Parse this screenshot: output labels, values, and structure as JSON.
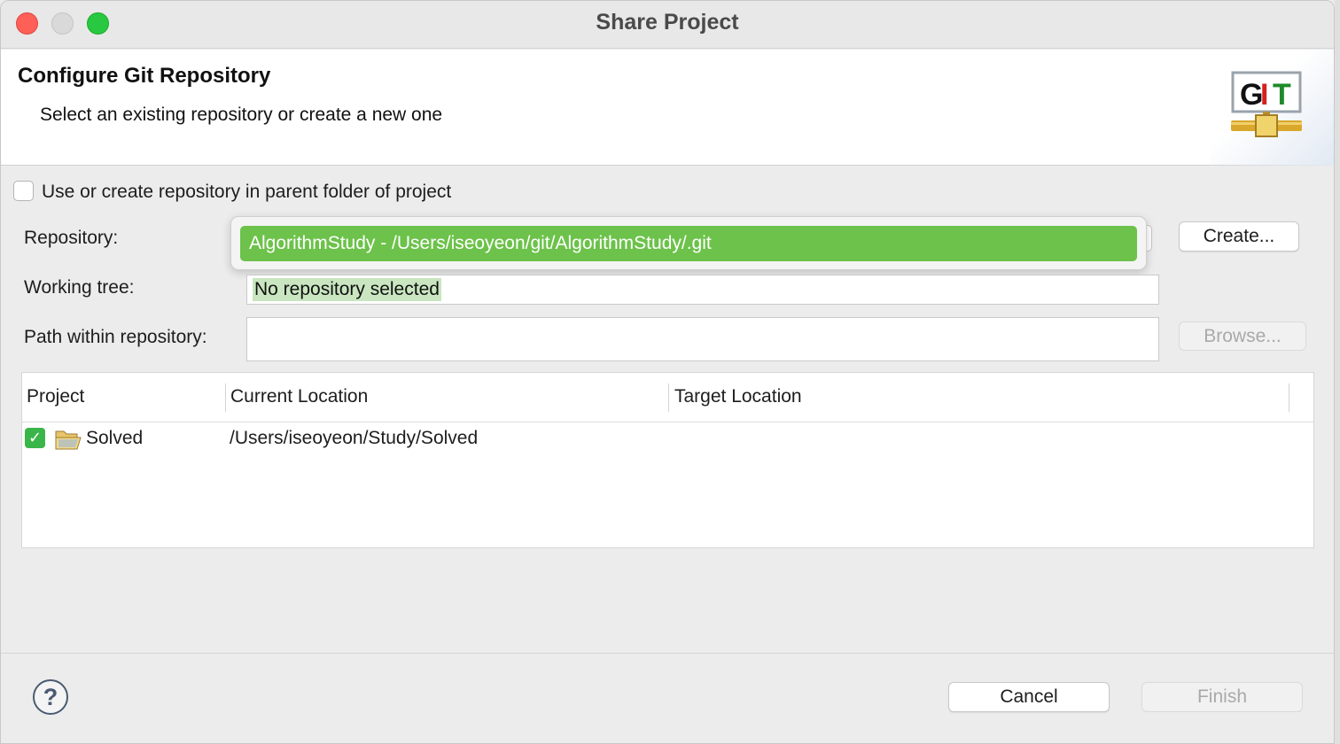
{
  "window": {
    "title": "Share Project"
  },
  "header": {
    "title": "Configure Git Repository",
    "subtitle": "Select an existing repository or create a new one",
    "logo_text": "GIT"
  },
  "parent_folder_option": {
    "label": "Use or create repository in parent folder of project",
    "checked": false
  },
  "form": {
    "repository_label": "Repository:",
    "repository_popup_item": "AlgorithmStudy - /Users/iseoyeon/git/AlgorithmStudy/.git",
    "create_label": "Create...",
    "working_tree_label": "Working tree:",
    "working_tree_value": "No repository selected",
    "path_label": "Path within repository:",
    "path_value": "",
    "browse_label": "Browse..."
  },
  "table": {
    "columns": [
      "Project",
      "Current Location",
      "Target Location"
    ],
    "rows": [
      {
        "project": "Solved",
        "current": "/Users/iseoyeon/Study/Solved",
        "target": "",
        "checked": true
      }
    ]
  },
  "footer": {
    "help_glyph": "?",
    "cancel_label": "Cancel",
    "finish_label": "Finish"
  },
  "colors": {
    "selection_green": "#6cc24a",
    "checkbox_green": "#3ab54a",
    "close": "#fe5f57",
    "zoom": "#28c840"
  }
}
